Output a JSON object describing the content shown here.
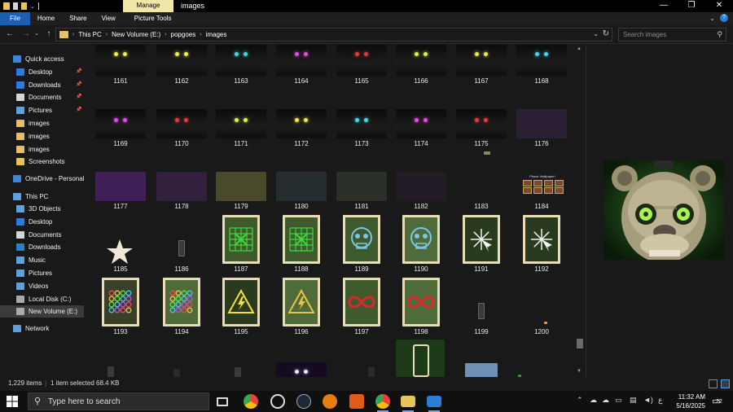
{
  "window": {
    "title": "images",
    "manage_tab": "Manage",
    "min": "—",
    "max": "❐",
    "close": "✕"
  },
  "ribbon": {
    "tabs": [
      "File",
      "Home",
      "Share",
      "View",
      "Picture Tools"
    ]
  },
  "address": {
    "crumbs": [
      "This PC",
      "New Volume (E:)",
      "popgoes",
      "images"
    ],
    "search_placeholder": "Search images"
  },
  "sidebar": {
    "items": [
      {
        "label": "Quick access",
        "icon": "star-icon",
        "color": "#3a86d8",
        "pinned": false
      },
      {
        "label": "Desktop",
        "icon": "desktop-icon",
        "color": "#2a7fd4",
        "pinned": true
      },
      {
        "label": "Downloads",
        "icon": "download-icon",
        "color": "#2a7fd4",
        "pinned": true
      },
      {
        "label": "Documents",
        "icon": "documents-icon",
        "color": "#d6d6d6",
        "pinned": true
      },
      {
        "label": "Pictures",
        "icon": "pictures-icon",
        "color": "#5fa1e0",
        "pinned": true
      },
      {
        "label": "images",
        "icon": "folder-icon",
        "color": "#e8c35b",
        "pinned": false
      },
      {
        "label": "images",
        "icon": "folder-icon",
        "color": "#e8c35b",
        "pinned": false
      },
      {
        "label": "images",
        "icon": "folder-icon",
        "color": "#e8c35b",
        "pinned": false
      },
      {
        "label": "Screenshots",
        "icon": "folder-icon",
        "color": "#e8c35b",
        "pinned": false
      },
      {
        "label": "OneDrive - Personal",
        "icon": "cloud-icon",
        "color": "#3a86d8",
        "pinned": false
      },
      {
        "label": "This PC",
        "icon": "pc-icon",
        "color": "#5fa1e0",
        "pinned": false
      },
      {
        "label": "3D Objects",
        "icon": "cube-icon",
        "color": "#5fa1e0",
        "pinned": false
      },
      {
        "label": "Desktop",
        "icon": "desktop-icon",
        "color": "#2a7fd4",
        "pinned": false
      },
      {
        "label": "Documents",
        "icon": "documents-icon",
        "color": "#d6d6d6",
        "pinned": false
      },
      {
        "label": "Downloads",
        "icon": "download-icon",
        "color": "#2a7fd4",
        "pinned": false
      },
      {
        "label": "Music",
        "icon": "music-icon",
        "color": "#5fa1e0",
        "pinned": false
      },
      {
        "label": "Pictures",
        "icon": "pictures-icon",
        "color": "#5fa1e0",
        "pinned": false
      },
      {
        "label": "Videos",
        "icon": "videos-icon",
        "color": "#5fa1e0",
        "pinned": false
      },
      {
        "label": "Local Disk (C:)",
        "icon": "drive-icon",
        "color": "#aaaaaa",
        "pinned": false
      },
      {
        "label": "New Volume (E:)",
        "icon": "drive-icon",
        "color": "#aaaaaa",
        "pinned": false,
        "selected": true
      },
      {
        "label": "Network",
        "icon": "network-icon",
        "color": "#5fa1e0",
        "pinned": false
      }
    ]
  },
  "files": {
    "row1": [
      {
        "name": "1161",
        "eye": "#f2f24a"
      },
      {
        "name": "1162",
        "eye": "#f2f24a"
      },
      {
        "name": "1163",
        "eye": "#3fd8e8"
      },
      {
        "name": "1164",
        "eye": "#e64ae6"
      },
      {
        "name": "1165",
        "eye": "#e83a3a"
      },
      {
        "name": "1166",
        "eye": "#d8f24a"
      },
      {
        "name": "1167",
        "eye": "#e8e84a"
      },
      {
        "name": "1168",
        "eye": "#3fd8e8"
      }
    ],
    "row2": [
      {
        "name": "1169",
        "eye": "#e64ae6"
      },
      {
        "name": "1170",
        "eye": "#e83a3a"
      },
      {
        "name": "1171",
        "eye": "#d8f24a"
      },
      {
        "name": "1172",
        "eye": "#e8e84a"
      },
      {
        "name": "1173",
        "eye": "#3fd8e8"
      },
      {
        "name": "1174",
        "eye": "#e64ae6"
      },
      {
        "name": "1175",
        "eye": "#e83a3a"
      },
      {
        "name": "1176",
        "eye": ""
      }
    ],
    "row3": [
      "1177",
      "1178",
      "1179",
      "1180",
      "1181",
      "1182",
      "1183",
      "1184"
    ],
    "row4": [
      "1185",
      "1186",
      "1187",
      "1188",
      "1189",
      "1190",
      "1191",
      "1192"
    ],
    "row5": [
      "1193",
      "1194",
      "1195",
      "1196",
      "1197",
      "1198",
      "1199",
      "1200"
    ],
    "wallpaper_title": "Phase Wallpaper!"
  },
  "status": {
    "count": "1,229 items",
    "selected": "1 item selected  68.4 KB"
  },
  "taskbar": {
    "search_placeholder": "Type here to search",
    "time": "11:32 AM",
    "date": "5/16/2025",
    "notifications": "22"
  }
}
